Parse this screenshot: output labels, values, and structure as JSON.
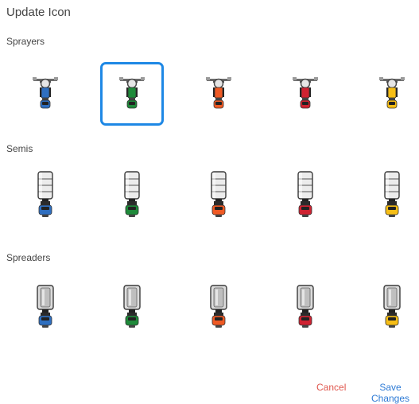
{
  "dialog": {
    "title": "Update Icon"
  },
  "colors": {
    "blue": "#2f6fc0",
    "green": "#1f8a3a",
    "orange": "#ef5a24",
    "red": "#cf2231",
    "yellow": "#f6be16",
    "selection": "#1e88e5",
    "cancel": "#e0574e",
    "save": "#2e7bd6"
  },
  "sections": [
    {
      "label": "Sprayers",
      "kind": "sprayer",
      "icons": [
        {
          "name": "sprayer-blue-icon",
          "color": "blue",
          "selected": false
        },
        {
          "name": "sprayer-green-icon",
          "color": "green",
          "selected": true
        },
        {
          "name": "sprayer-orange-icon",
          "color": "orange",
          "selected": false
        },
        {
          "name": "sprayer-red-icon",
          "color": "red",
          "selected": false
        },
        {
          "name": "sprayer-yellow-icon",
          "color": "yellow",
          "selected": false
        }
      ]
    },
    {
      "label": "Semis",
      "kind": "semi",
      "icons": [
        {
          "name": "semi-blue-icon",
          "color": "blue",
          "selected": false
        },
        {
          "name": "semi-green-icon",
          "color": "green",
          "selected": false
        },
        {
          "name": "semi-orange-icon",
          "color": "orange",
          "selected": false
        },
        {
          "name": "semi-red-icon",
          "color": "red",
          "selected": false
        },
        {
          "name": "semi-yellow-icon",
          "color": "yellow",
          "selected": false
        }
      ]
    },
    {
      "label": "Spreaders",
      "kind": "spreader",
      "icons": [
        {
          "name": "spreader-blue-icon",
          "color": "blue",
          "selected": false
        },
        {
          "name": "spreader-green-icon",
          "color": "green",
          "selected": false
        },
        {
          "name": "spreader-orange-icon",
          "color": "orange",
          "selected": false
        },
        {
          "name": "spreader-red-icon",
          "color": "red",
          "selected": false
        },
        {
          "name": "spreader-yellow-icon",
          "color": "yellow",
          "selected": false
        }
      ]
    }
  ],
  "footer": {
    "cancel_label": "Cancel",
    "save_label": "Save Changes"
  }
}
